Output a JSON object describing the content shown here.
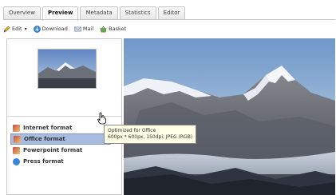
{
  "tabs": [
    "Overview",
    "Preview",
    "Metadata",
    "Statistics",
    "Editor"
  ],
  "active_tab": "Preview",
  "toolbar": {
    "edit": "Edit",
    "download": "Download",
    "mail": "Mail",
    "basket": "Basket"
  },
  "formats": [
    {
      "label": "Internet format",
      "icon": "image-file-icon"
    },
    {
      "label": "Office format",
      "icon": "image-file-icon"
    },
    {
      "label": "Powerpoint format",
      "icon": "image-file-icon"
    },
    {
      "label": "Press format",
      "icon": "help-circle-icon"
    }
  ],
  "highlighted_format": "Office format",
  "tooltip": {
    "line1": "Optimized for Office",
    "line2": "600px * 600px, 150dpi, JPEG (RGB)"
  },
  "colors": {
    "highlight": "#a9bce0",
    "tooltip_bg": "#ffffe6",
    "sky": "#9bb8d6"
  }
}
